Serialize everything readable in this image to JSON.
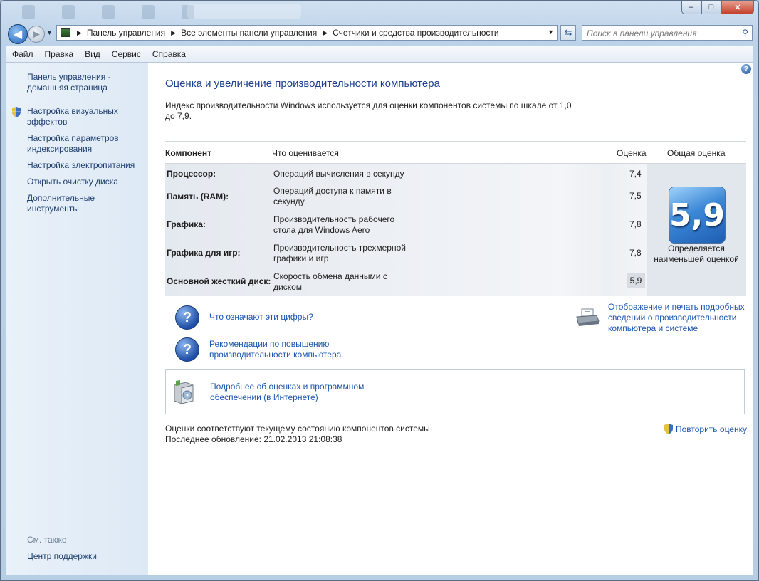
{
  "window": {
    "controls": {
      "minimize": "–",
      "maximize": "□",
      "close": "✕"
    }
  },
  "nav": {
    "breadcrumbs": [
      "Панель управления",
      "Все элементы панели управления",
      "Счетчики и средства производительности"
    ],
    "search_placeholder": "Поиск в панели управления"
  },
  "menu": [
    "Файл",
    "Правка",
    "Вид",
    "Сервис",
    "Справка"
  ],
  "sidebar": {
    "items": [
      "Панель управления - домашняя страница",
      "Настройка визуальных эффектов",
      "Настройка параметров индексирования",
      "Настройка электропитания",
      "Открыть очистку диска",
      "Дополнительные инструменты"
    ],
    "see_also_label": "См. также",
    "see_also_items": [
      "Центр поддержки"
    ]
  },
  "main": {
    "title": "Оценка и увеличение производительности компьютера",
    "intro": "Индекс производительности Windows используется для оценки компонентов системы по шкале от 1,0 до 7,9.",
    "table": {
      "headers": {
        "component": "Компонент",
        "what": "Что оценивается",
        "score": "Оценка",
        "overall": "Общая оценка"
      },
      "rows": [
        {
          "component": "Процессор:",
          "what": "Операций вычисления в секунду",
          "score": "7,4"
        },
        {
          "component": "Память (RAM):",
          "what": "Операций доступа к памяти в секунду",
          "score": "7,5"
        },
        {
          "component": "Графика:",
          "what": "Производительность рабочего стола для Windows Aero",
          "score": "7,8"
        },
        {
          "component": "Графика для игр:",
          "what": "Производительность трехмерной графики и игр",
          "score": "7,8"
        },
        {
          "component": "Основной жесткий диск:",
          "what": "Скорость обмена данными с диском",
          "score": "5,9"
        }
      ],
      "overall_score": "5,9",
      "overall_caption": "Определяется наименьшей оценкой"
    },
    "links": {
      "what_numbers": "Что означают эти цифры?",
      "recommendations": "Рекомендации по повышению производительности компьютера.",
      "print_details": "Отображение и печать подробных сведений о производительности компьютера и системе",
      "more_info": "Подробнее об оценках и программном обеспечении (в Интернете)"
    },
    "status_line1": "Оценки соответствуют текущему состоянию компонентов системы",
    "status_line2": "Последнее обновление: 21.02.2013 21:08:38",
    "repeat_label": "Повторить оценку"
  },
  "colors": {
    "link": "#1d56b0",
    "title": "#1e3f8f",
    "badge": "#2f78cc"
  }
}
